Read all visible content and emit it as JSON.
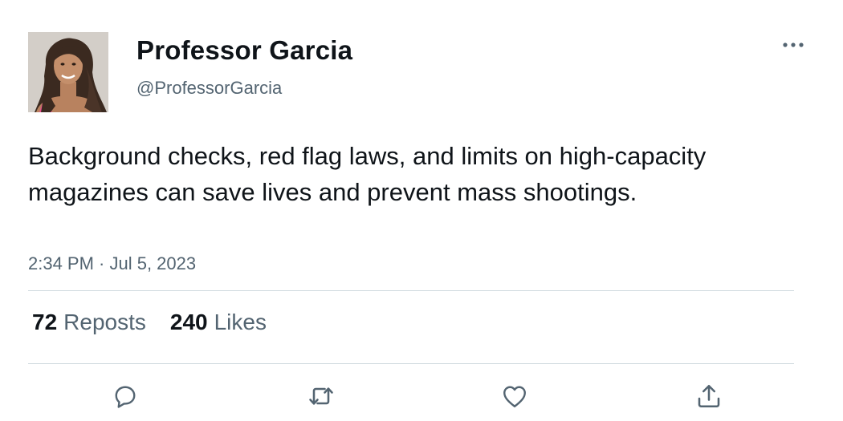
{
  "author": {
    "name": "Professor Garcia",
    "handle": "@ProfessorGarcia"
  },
  "tweet": {
    "text": "Background checks, red flag laws, and limits on high-capacity magazines can save lives and prevent mass shootings.",
    "timestamp": "2:34 PM · Jul 5, 2023"
  },
  "stats": {
    "reposts_count": "72",
    "reposts_label": "Reposts",
    "likes_count": "240",
    "likes_label": "Likes"
  },
  "icons": {
    "more": "more-horizontal-icon",
    "reply": "reply-icon",
    "repost": "repost-icon",
    "like": "heart-icon",
    "share": "share-icon"
  },
  "colors": {
    "text_primary": "#0f1419",
    "text_secondary": "#536471",
    "divider": "#cfd9de"
  }
}
